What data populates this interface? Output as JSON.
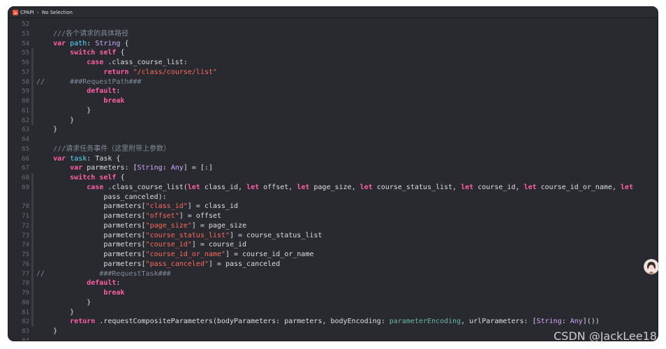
{
  "jumpbar": {
    "project": "CPAPI",
    "selection": "No Selection"
  },
  "line_numbers": [
    "52",
    "53",
    "54",
    "55",
    "56",
    "57",
    "58",
    "59",
    "60",
    "61",
    "62",
    "63",
    "64",
    "65",
    "66",
    "67",
    "68",
    "69",
    "",
    "70",
    "71",
    "72",
    "73",
    "74",
    "75",
    "76",
    "77",
    "78",
    "79",
    "80",
    "81",
    "82",
    "83",
    "84"
  ],
  "code_lines": [
    [],
    [
      [
        "cmt",
        "    ///"
      ],
      [
        "cmt",
        "各个请求的具体路径"
      ]
    ],
    [
      [
        "kw",
        "    var"
      ],
      [
        "plain",
        " "
      ],
      [
        "prop",
        "path"
      ],
      [
        "plain",
        ": "
      ],
      [
        "ty",
        "String"
      ],
      [
        "plain",
        " {"
      ]
    ],
    [
      [
        "kw",
        "        switch"
      ],
      [
        "plain",
        " "
      ],
      [
        "kw",
        "self"
      ],
      [
        "plain",
        " {"
      ]
    ],
    [
      [
        "kw",
        "            case"
      ],
      [
        "plain",
        " .class_course_list:"
      ]
    ],
    [
      [
        "kw",
        "                return"
      ],
      [
        "plain",
        " "
      ],
      [
        "str",
        "\"/class/course/list\""
      ]
    ],
    [
      [
        "cmt",
        "//      ###RequestPath###"
      ]
    ],
    [
      [
        "kw",
        "            default"
      ],
      [
        "plain",
        ":"
      ]
    ],
    [
      [
        "kw",
        "                break"
      ]
    ],
    [
      [
        "plain",
        "            }"
      ]
    ],
    [
      [
        "plain",
        "        }"
      ]
    ],
    [
      [
        "plain",
        "    }"
      ]
    ],
    [],
    [
      [
        "cmt",
        "    ///"
      ],
      [
        "cmt",
        "请求任务事件（这里附带上参数）"
      ]
    ],
    [
      [
        "kw",
        "    var"
      ],
      [
        "plain",
        " "
      ],
      [
        "prop",
        "task"
      ],
      [
        "plain",
        ": Task {"
      ]
    ],
    [
      [
        "kw",
        "        var"
      ],
      [
        "plain",
        " parmeters: ["
      ],
      [
        "ty",
        "String"
      ],
      [
        "plain",
        ": "
      ],
      [
        "ty",
        "Any"
      ],
      [
        "plain",
        "] = [:]"
      ]
    ],
    [
      [
        "kw",
        "        switch"
      ],
      [
        "plain",
        " "
      ],
      [
        "kw",
        "self"
      ],
      [
        "plain",
        " {"
      ]
    ],
    [
      [
        "kw",
        "            case"
      ],
      [
        "plain",
        " .class_course_list("
      ],
      [
        "kw",
        "let"
      ],
      [
        "plain",
        " class_id, "
      ],
      [
        "kw",
        "let"
      ],
      [
        "plain",
        " offset, "
      ],
      [
        "kw",
        "let"
      ],
      [
        "plain",
        " page_size, "
      ],
      [
        "kw",
        "let"
      ],
      [
        "plain",
        " course_status_list, "
      ],
      [
        "kw",
        "let"
      ],
      [
        "plain",
        " course_id, "
      ],
      [
        "kw",
        "let"
      ],
      [
        "plain",
        " course_id_or_name, "
      ],
      [
        "kw",
        "let"
      ]
    ],
    [
      [
        "plain",
        "                pass_canceled):"
      ]
    ],
    [
      [
        "plain",
        "                parmeters["
      ],
      [
        "str",
        "\"class_id\""
      ],
      [
        "plain",
        "] = class_id"
      ]
    ],
    [
      [
        "plain",
        "                parmeters["
      ],
      [
        "str",
        "\"offset\""
      ],
      [
        "plain",
        "] = offset"
      ]
    ],
    [
      [
        "plain",
        "                parmeters["
      ],
      [
        "str",
        "\"page_size\""
      ],
      [
        "plain",
        "] = page_size"
      ]
    ],
    [
      [
        "plain",
        "                parmeters["
      ],
      [
        "str",
        "\"course_status_list\""
      ],
      [
        "plain",
        "] = course_status_list"
      ]
    ],
    [
      [
        "plain",
        "                parmeters["
      ],
      [
        "str",
        "\"course_id\""
      ],
      [
        "plain",
        "] = course_id"
      ]
    ],
    [
      [
        "plain",
        "                parmeters["
      ],
      [
        "str",
        "\"course_id_or_name\""
      ],
      [
        "plain",
        "] = course_id_or_name"
      ]
    ],
    [
      [
        "plain",
        "                parmeters["
      ],
      [
        "str",
        "\"pass_canceled\""
      ],
      [
        "plain",
        "] = pass_canceled"
      ]
    ],
    [
      [
        "cmt",
        "//             ###RequestTask###"
      ]
    ],
    [
      [
        "kw",
        "            default"
      ],
      [
        "plain",
        ":"
      ]
    ],
    [
      [
        "kw",
        "                break"
      ]
    ],
    [
      [
        "plain",
        "            }"
      ]
    ],
    [
      [
        "plain",
        "        }"
      ]
    ],
    [
      [
        "kw",
        "        return"
      ],
      [
        "plain",
        " .requestCompositeParameters(bodyParameters: parmeters, bodyEncoding: "
      ],
      [
        "var",
        "parameterEncoding"
      ],
      [
        "plain",
        ", urlParameters: ["
      ],
      [
        "ty",
        "String"
      ],
      [
        "plain",
        ": "
      ],
      [
        "ty",
        "Any"
      ],
      [
        "plain",
        "]())"
      ]
    ],
    [
      [
        "plain",
        "    }"
      ]
    ],
    []
  ],
  "watermark": "CSDN @JackLee18"
}
